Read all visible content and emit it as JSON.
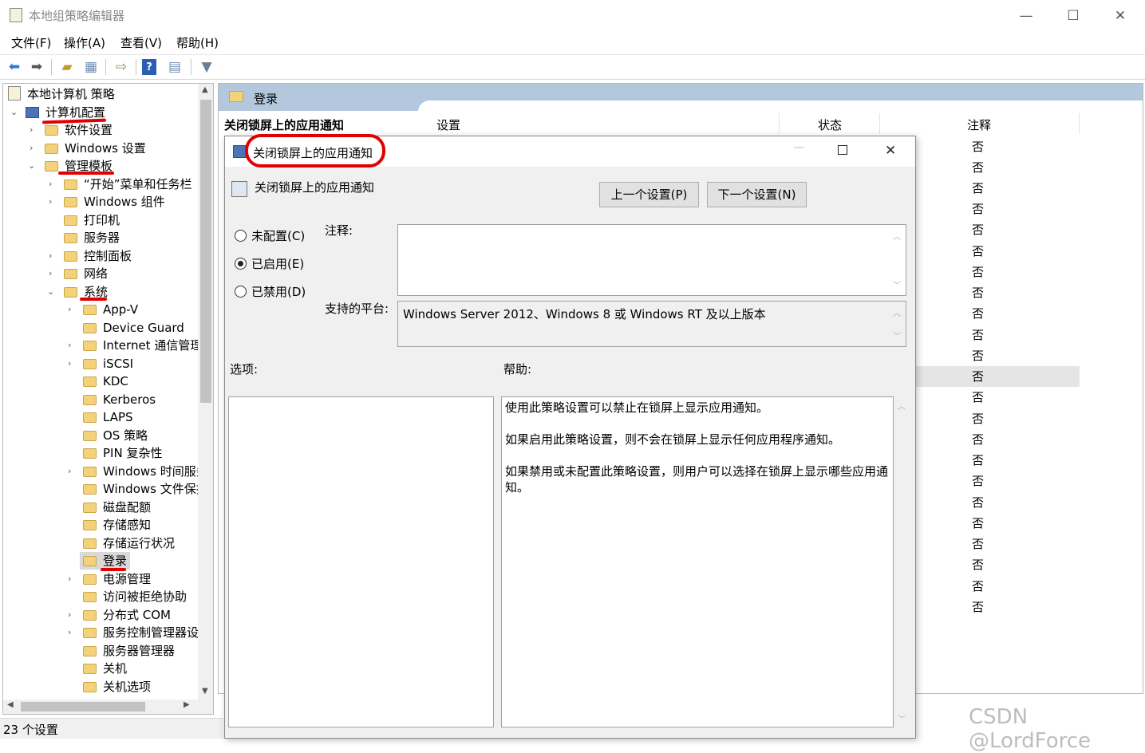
{
  "window": {
    "title": "本地组策略编辑器",
    "minimize_glyph": "—",
    "maximize_glyph": "☐",
    "close_glyph": "✕"
  },
  "menu": [
    "文件(F)",
    "操作(A)",
    "查看(V)",
    "帮助(H)"
  ],
  "toolbar": {
    "icons": [
      "back-icon",
      "forward-icon",
      "up-folder-icon",
      "show-hide-tree-icon",
      "export-list-icon",
      "help-icon",
      "properties-icon",
      "filter-icon"
    ]
  },
  "tree": {
    "root": "本地计算机 策略",
    "computer_config": "计算机配置",
    "nodes": [
      "软件设置",
      "Windows 设置",
      "管理模板",
      "“开始”菜单和任务栏",
      "Windows 组件",
      "打印机",
      "服务器",
      "控制面板",
      "网络",
      "系统",
      "App-V",
      "Device Guard",
      "Internet 通信管理",
      "iSCSI",
      "KDC",
      "Kerberos",
      "LAPS",
      "OS 策略",
      "PIN 复杂性",
      "Windows 时间服务",
      "Windows 文件保护",
      "磁盘配额",
      "存储感知",
      "存储运行状况",
      "登录",
      "电源管理",
      "访问被拒绝协助",
      "分布式 COM",
      "服务控制管理器设置",
      "服务器管理器",
      "关机",
      "关机选项"
    ]
  },
  "status": "23 个设置",
  "right": {
    "header_title": "登录",
    "selected_policy": "关闭锁屏上的应用通知",
    "col_setting": "设置",
    "col_state": "状态",
    "col_note": "注释",
    "note_values": [
      "否",
      "否",
      "否",
      "否",
      "否",
      "否",
      "否",
      "否",
      "否",
      "否",
      "否",
      "否",
      "否",
      "否",
      "否",
      "否",
      "否",
      "否",
      "否",
      "否",
      "否",
      "否",
      "否"
    ]
  },
  "dialog": {
    "title": "关闭锁屏上的应用通知",
    "subtitle": "关闭锁屏上的应用通知",
    "prev_button": "上一个设置(P)",
    "next_button": "下一个设置(N)",
    "radio_not_configured": "未配置(C)",
    "radio_enabled": "已启用(E)",
    "radio_disabled": "已禁用(D)",
    "selected_option": "已启用(E)",
    "comment_label": "注释:",
    "platform_label": "支持的平台:",
    "platform_value": "Windows Server 2012、Windows 8 或 Windows RT 及以上版本",
    "options_label": "选项:",
    "help_label": "帮助:",
    "help_p1": "使用此策略设置可以禁止在锁屏上显示应用通知。",
    "help_p2": "如果启用此策略设置，则不会在锁屏上显示任何应用程序通知。",
    "help_p3": "如果禁用或未配置此策略设置，则用户可以选择在锁屏上显示哪些应用通知。"
  },
  "watermark": "CSDN @LordForce",
  "colors": {
    "accent_header": "#b3c8dc",
    "annotation_red": "#e10000",
    "folder": "#f4d27a"
  }
}
